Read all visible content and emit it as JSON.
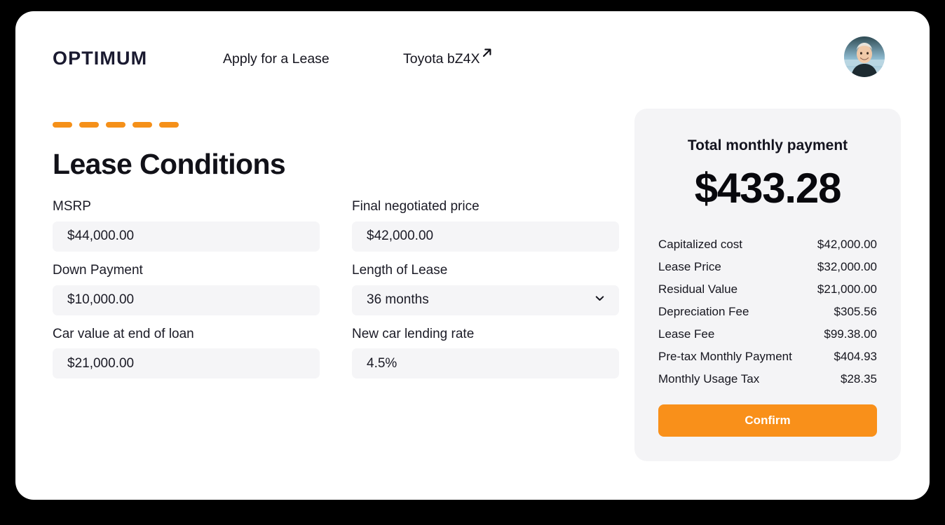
{
  "header": {
    "logo": "OPTIMUM",
    "nav": [
      {
        "label": "Apply for a Lease",
        "name": "nav-apply-for-a-lease"
      },
      {
        "label": "Toyota bZ4X",
        "name": "nav-toyota-bz4x",
        "icon": "arrow-up-right-icon"
      }
    ],
    "avatar_icon": "user-avatar-photo"
  },
  "progress": {
    "steps": 5,
    "color": "#f59019"
  },
  "form": {
    "title": "Lease Conditions",
    "fields": [
      {
        "label": "MSRP",
        "value": "$44,000.00",
        "type": "text",
        "name": "msrp"
      },
      {
        "label": "Final negotiated price",
        "value": "$42,000.00",
        "type": "text",
        "name": "final-negotiated-price"
      },
      {
        "label": "Down Payment",
        "value": "$10,000.00",
        "type": "text",
        "name": "down-payment"
      },
      {
        "label": "Length of Lease",
        "value": "36 months",
        "type": "select",
        "name": "length-of-lease",
        "icon": "chevron-down-icon"
      },
      {
        "label": "Car value at end of loan",
        "value": "$21,000.00",
        "type": "text",
        "name": "car-value-at-end-of-loan"
      },
      {
        "label": "New car lending rate",
        "value": "4.5%",
        "type": "text",
        "name": "new-car-lending-rate"
      }
    ]
  },
  "summary": {
    "title": "Total monthly payment",
    "total": "$433.28",
    "rows": [
      {
        "label": "Capitalized cost",
        "value": "$42,000.00"
      },
      {
        "label": "Lease Price",
        "value": "$32,000.00"
      },
      {
        "label": "Residual Value",
        "value": "$21,000.00"
      },
      {
        "label": "Depreciation Fee",
        "value": "$305.56"
      },
      {
        "label": "Lease Fee",
        "value": "$99.38.00"
      },
      {
        "label": "Pre-tax Monthly Payment",
        "value": "$404.93"
      },
      {
        "label": "Monthly Usage Tax",
        "value": "$28.35"
      }
    ],
    "confirm_label": "Confirm",
    "confirm_color": "#f9901a"
  }
}
